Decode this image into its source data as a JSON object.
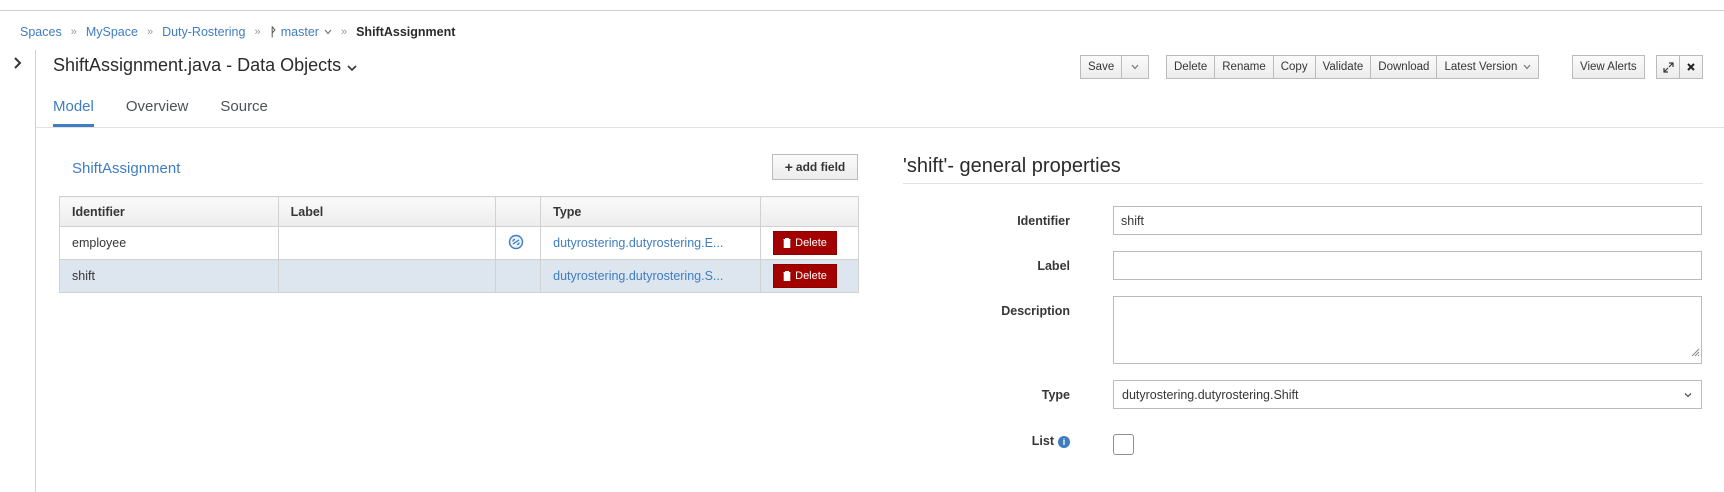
{
  "breadcrumb": {
    "items": [
      "Spaces",
      "MySpace",
      "Duty-Rostering"
    ],
    "branch": "master",
    "current": "ShiftAssignment",
    "separator": "»"
  },
  "header": {
    "title": "ShiftAssignment.java - Data Objects"
  },
  "toolbar": {
    "save": "Save",
    "delete": "Delete",
    "rename": "Rename",
    "copy": "Copy",
    "validate": "Validate",
    "download": "Download",
    "latest_version": "Latest Version",
    "view_alerts": "View Alerts"
  },
  "tabs": [
    {
      "label": "Model",
      "active": true
    },
    {
      "label": "Overview",
      "active": false
    },
    {
      "label": "Source",
      "active": false
    }
  ],
  "data_object": {
    "name": "ShiftAssignment",
    "add_field_label": "add field",
    "columns": [
      "Identifier",
      "Label",
      "",
      "Type",
      ""
    ],
    "rows": [
      {
        "identifier": "employee",
        "label": "",
        "has_link_icon": true,
        "type": "dutyrostering.dutyrostering.E...",
        "delete_label": "Delete",
        "selected": false
      },
      {
        "identifier": "shift",
        "label": "",
        "has_link_icon": false,
        "type": "dutyrostering.dutyrostering.S...",
        "delete_label": "Delete",
        "selected": true
      }
    ]
  },
  "properties": {
    "title": "'shift'- general properties",
    "identifier_label": "Identifier",
    "identifier_value": "shift",
    "label_label": "Label",
    "label_value": "",
    "description_label": "Description",
    "description_value": "",
    "type_label": "Type",
    "type_value": "dutyrostering.dutyrostering.Shift",
    "list_label": "List",
    "list_checked": false
  },
  "colors": {
    "accent": "#3f7dc0",
    "delete_button": "#a30000",
    "selected_row": "#dde6ef"
  }
}
